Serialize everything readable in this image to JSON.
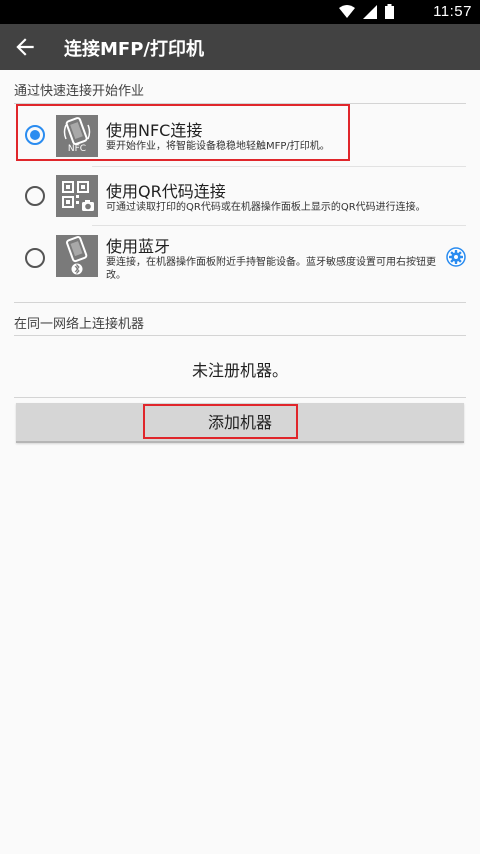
{
  "status_bar": {
    "time": "11:57",
    "icons": [
      "wifi-icon",
      "signal-icon",
      "battery-icon"
    ]
  },
  "app_bar": {
    "title": "连接MFP/打印机",
    "back_icon": "arrow-back-icon"
  },
  "quick_connect": {
    "section_label": "通过快速连接开始作业",
    "options": [
      {
        "title": "使用NFC连接",
        "description": "要开始作业，将智能设备稳稳地轻触MFP/打印机。",
        "icon": "nfc-phone-icon",
        "icon_text": "NFC",
        "selected": true
      },
      {
        "title": "使用QR代码连接",
        "description": "可通过读取打印的QR代码或在机器操作面板上显示的QR代码进行连接。",
        "icon": "qr-code-icon",
        "selected": false
      },
      {
        "title": "使用蓝牙",
        "description": "要连接，在机器操作面板附近手持智能设备。蓝牙敏感度设置可用右按钮更改。",
        "icon": "bluetooth-phone-icon",
        "selected": false,
        "settings_icon": "gear-icon"
      }
    ]
  },
  "network": {
    "section_label": "在同一网络上连接机器",
    "empty_message": "未注册机器。",
    "add_button_label": "添加机器"
  },
  "colors": {
    "accent": "#2a8cf0",
    "app_bar": "#424242",
    "highlight": "#e0262b",
    "button": "#d6d6d6"
  }
}
